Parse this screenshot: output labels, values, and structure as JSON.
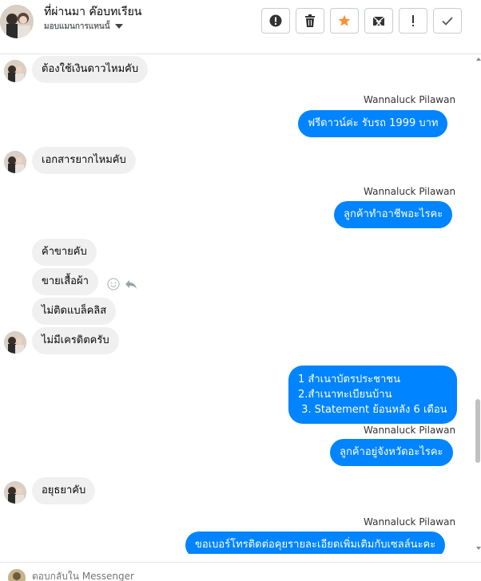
{
  "header": {
    "title": "ที่ผ่านมา ค๊อบทเรียน",
    "subtitle": "มอบแมนการแทนนั้",
    "buttons": [
      {
        "name": "spam-button",
        "icon": "alert-circle-icon"
      },
      {
        "name": "delete-button",
        "icon": "trash-icon"
      },
      {
        "name": "star-button",
        "icon": "star-icon"
      },
      {
        "name": "archive-button",
        "icon": "envelope-x-icon"
      },
      {
        "name": "report-button",
        "icon": "exclamation-icon"
      },
      {
        "name": "done-button",
        "icon": "check-icon"
      }
    ],
    "star_color": "#f7923a"
  },
  "messages": [
    {
      "dir": "in",
      "text": "ต้องใช้เงินดาวไหมคับ"
    },
    {
      "dir": "out",
      "sender": "Wannaluck Pilawan",
      "text": "ฟรีดาวน์ค่ะ  รับรถ 1999  บาท"
    },
    {
      "dir": "in",
      "text": "เอกสารยากไหมคับ"
    },
    {
      "dir": "out",
      "sender": "Wannaluck Pilawan",
      "text": "ลูกค้าทำอาชีพอะไรคะ"
    },
    {
      "dir": "in",
      "text": "ค้าขายคับ"
    },
    {
      "dir": "in",
      "text": "ขายเสื้อผ้า"
    },
    {
      "dir": "in",
      "text": "ไม่ติดแบล็คลิส"
    },
    {
      "dir": "in",
      "text": "ไม่มีเครดิตครับ"
    },
    {
      "dir": "out",
      "sender": "",
      "lines": [
        "1 สำเนาบัตรประชาชน",
        "2.สำเนาทะเบียนบ้าน",
        " 3. Statement ย้อนหลัง 6 เดือน"
      ]
    },
    {
      "dir": "out",
      "sender": "Wannaluck Pilawan",
      "text": "ลูกค้าอยู่จังหวัดอะไรคะ"
    },
    {
      "dir": "in",
      "text": "อยุธยาคับ"
    },
    {
      "dir": "out",
      "sender": "Wannaluck Pilawan",
      "text": "ขอเบอร์โทรติดต่อคุยรายละเอียดเพิ่มเติมกับเซลล์นะคะ"
    }
  ],
  "composer": {
    "placeholder": "ตอบกลับใน Messenger"
  },
  "colors": {
    "outgoing": "#0084ff",
    "incoming": "#f0f0f0"
  }
}
